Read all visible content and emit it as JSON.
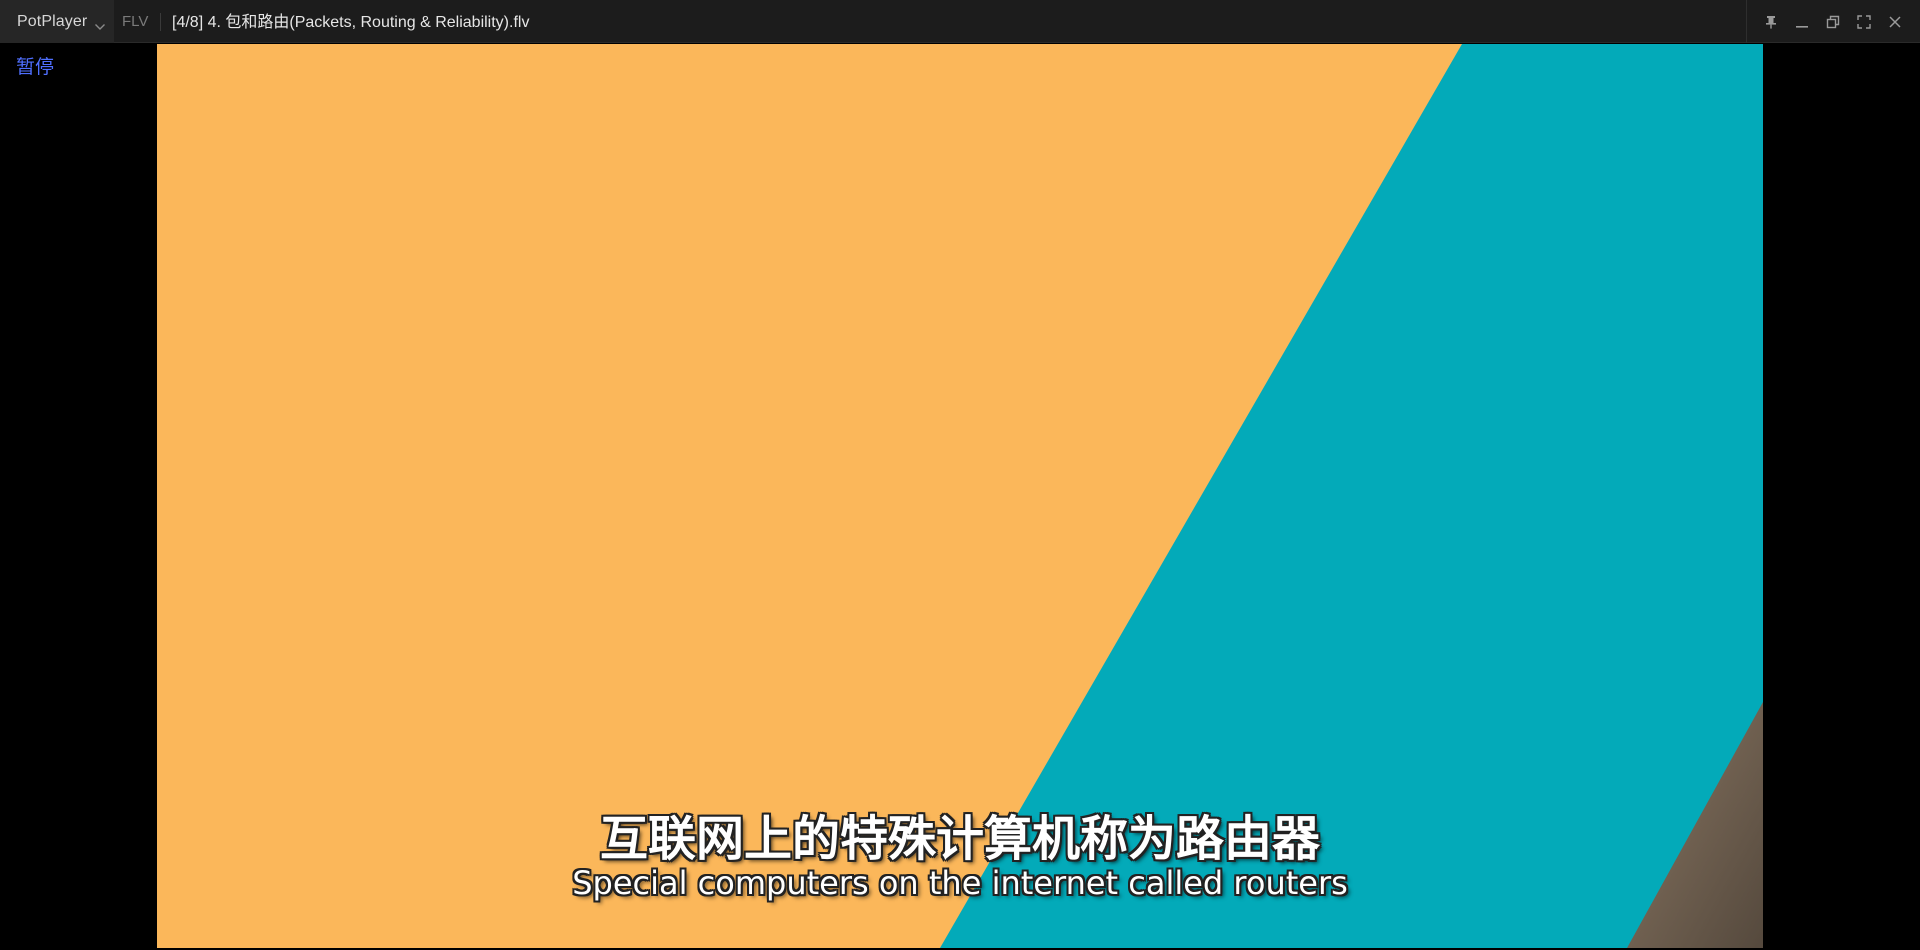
{
  "titlebar": {
    "app_name": "PotPlayer",
    "format": "FLV",
    "file_title": "[4/8] 4. 包和路由(Packets, Routing & Reliability).flv"
  },
  "window_controls": {
    "pin_icon": "pin-icon",
    "minimize_icon": "minimize-icon",
    "restore_icon": "restore-icon",
    "fullscreen_icon": "fullscreen-icon",
    "close_icon": "close-icon"
  },
  "osd": {
    "status": "暂停"
  },
  "subtitles": {
    "chinese": "互联网上的特殊计算机称为路由器",
    "english": "Special computers on the internet called routers"
  },
  "colors": {
    "titlebar_bg": "#1c1c1c",
    "video_orange": "#fbb75a",
    "video_teal": "#03aab9",
    "video_brown": "#6b5e4f",
    "osd_blue": "#4f6fff",
    "subtitle_text": "#ffffff"
  }
}
